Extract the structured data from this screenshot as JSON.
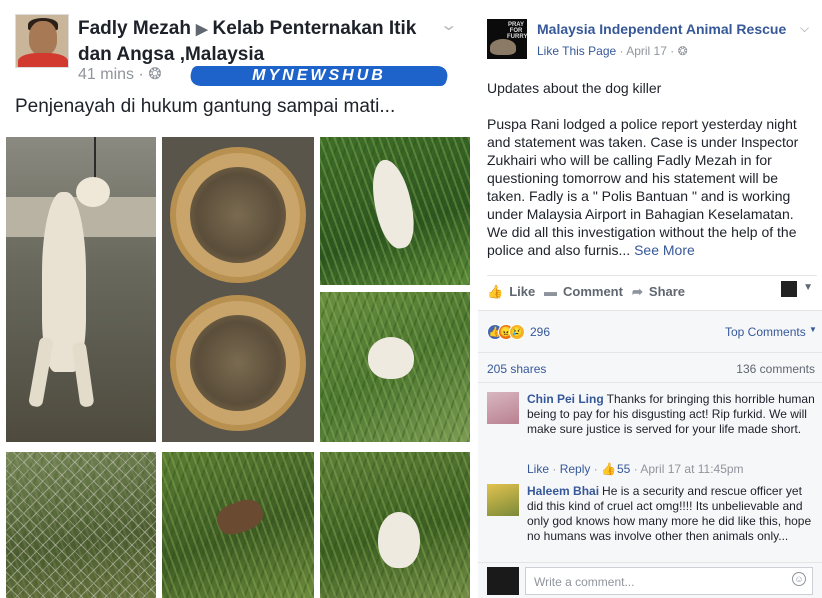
{
  "left_post": {
    "author": "Fadly Mezah",
    "arrow": "▶",
    "group": "Kelab Penternakan Itik dan Angsa ,Malaysia",
    "time": "41 mins",
    "audience_sep": "·",
    "watermark": "MYNEWSHUB",
    "status": "Penjenayah di hukum gantung sampai mati...",
    "photos": [
      "hanged-dog",
      "bowls",
      "duck-in-grass",
      "dead-duck",
      "fence-grass",
      "carcass-in-grass",
      "duck-in-weeds"
    ]
  },
  "page_post": {
    "page_name": "Malaysia Independent Animal Rescue",
    "avatar_text": "PRAY FOR FURRY",
    "like_page": "Like This Page",
    "date": "April 17",
    "sep": "·",
    "paragraph1": "Updates about the dog killer",
    "paragraph2": "Puspa Rani lodged a police report yesterday night and statement was taken. Case is under Inspector Zukhairi who will be calling Fadly Mezah in for questioning tomorrow and his statement will be taken. Fadly is a \" Polis Bantuan \" and is working under Malaysia Airport in Bahagian Keselamatan. We did all this investigation without the help of the police and also furnis...",
    "see_more": "See More"
  },
  "actions": {
    "like": "Like",
    "comment": "Comment",
    "share": "Share"
  },
  "reactions": {
    "count": "296",
    "top_comments": "Top Comments"
  },
  "stats": {
    "shares": "205 shares",
    "comments": "136 comments"
  },
  "comments": [
    {
      "name": "Chin Pei Ling",
      "text": "Thanks for bringing this horrible human being to pay for his disgusting act! Rip furkid. We will make sure justice is served for your life made short.",
      "like": "Like",
      "reply": "Reply",
      "likes": "55",
      "time": "April 17 at 11:45pm"
    },
    {
      "name": "Haleem Bhai",
      "text": "He is a security and rescue officer yet did this kind of cruel act omg!!!! Its unbelievable and only god knows how many more he did like this, hope no humans was involve other then animals only..."
    }
  ],
  "comment_input": {
    "placeholder": "Write a comment..."
  },
  "icons": {
    "like": "thumbs-up-icon",
    "comment": "speech-bubble-icon",
    "share": "share-arrow-icon",
    "globe": "globe-icon",
    "emoji": "smiley-icon"
  },
  "colors": {
    "link": "#365899",
    "meta": "#90949c",
    "brand": "#1e63c9",
    "like_reaction": "#4267b2"
  }
}
